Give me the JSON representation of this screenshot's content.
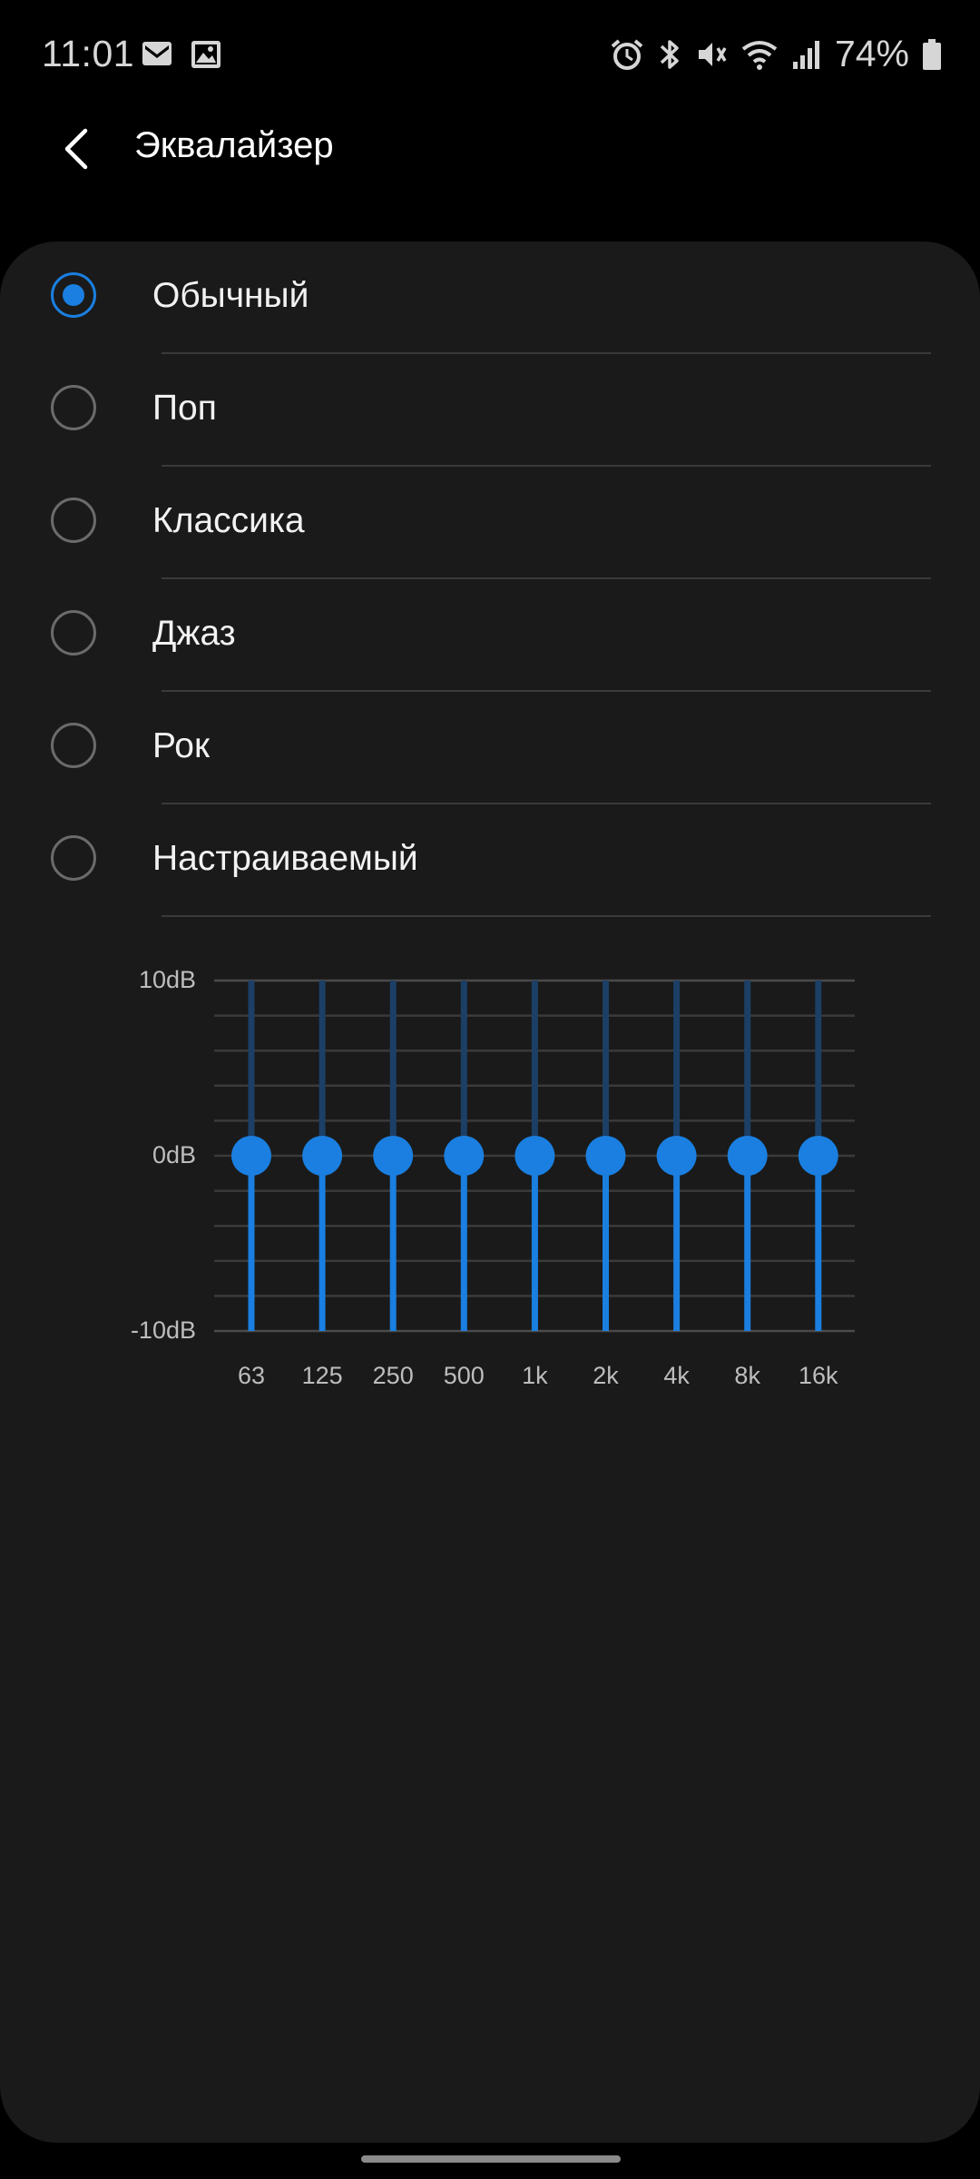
{
  "status_bar": {
    "time": "11:01",
    "left_icons": [
      "gmail-icon",
      "gallery-icon"
    ],
    "right_icons": [
      "alarm-icon",
      "bluetooth-icon",
      "mute-icon",
      "wifi-icon",
      "signal-icon",
      "battery-icon"
    ],
    "battery": "74%"
  },
  "app_bar": {
    "back_icon": "back-arrow-icon",
    "title": "Эквалайзер"
  },
  "presets": [
    {
      "label": "Обычный",
      "selected": true
    },
    {
      "label": "Поп",
      "selected": false
    },
    {
      "label": "Классика",
      "selected": false
    },
    {
      "label": "Джаз",
      "selected": false
    },
    {
      "label": "Рок",
      "selected": false
    },
    {
      "label": "Настраиваемый",
      "selected": false
    }
  ],
  "equalizer": {
    "db_labels": [
      "10dB",
      "0dB",
      "-10dB"
    ],
    "db_range": [
      -10,
      10
    ],
    "bands": [
      "63",
      "125",
      "250",
      "500",
      "1k",
      "2k",
      "4k",
      "8k",
      "16k"
    ],
    "gains_db": [
      0,
      0,
      0,
      0,
      0,
      0,
      0,
      0,
      0
    ],
    "accent_color": "#1a7fe0"
  }
}
